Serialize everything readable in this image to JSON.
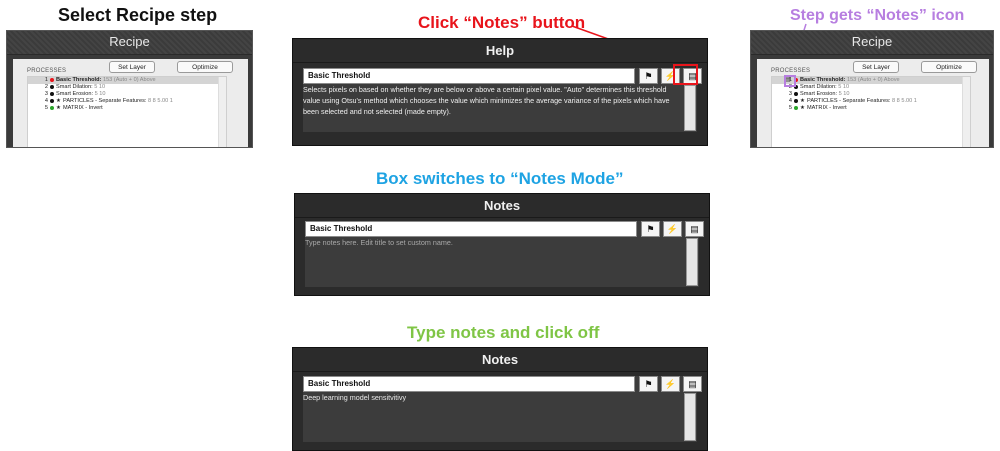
{
  "captions": {
    "select_step": "Select Recipe step",
    "click_notes": "Click “Notes” button",
    "step_gets_icon": "Step gets “Notes” icon",
    "box_switches": "Box switches to “Notes Mode”",
    "type_notes": "Type notes and click off"
  },
  "recipe_left": {
    "title": "Recipe",
    "processes_label": "PROCESSES",
    "set_layer": "Set Layer",
    "optimize": "Optimize",
    "items": [
      {
        "num": "1",
        "color": "#e8141b",
        "star": "",
        "name": "Basic Threshold:",
        "detail": "153 (Auto + 0) Above"
      },
      {
        "num": "2",
        "color": "#111111",
        "star": "",
        "name": "Smart Dilation:",
        "detail": "5 10"
      },
      {
        "num": "3",
        "color": "#111111",
        "star": "",
        "name": "Smart Erosion:",
        "detail": "5 10"
      },
      {
        "num": "4",
        "color": "#111111",
        "star": "★",
        "name": "PARTICLES - Separate Features:",
        "detail": "8 8 5.00 1"
      },
      {
        "num": "5",
        "color": "#2aa52a",
        "star": "★",
        "name": "MATRIX - Invert",
        "detail": ""
      }
    ]
  },
  "recipe_right": {
    "title": "Recipe",
    "processes_label": "PROCESSES",
    "set_layer": "Set Layer",
    "optimize": "Optimize",
    "items": [
      {
        "num": "1",
        "color": "#e8141b",
        "star": "",
        "name": "Basic Threshold:",
        "detail": "153 (Auto + 0) Above"
      },
      {
        "num": "2",
        "color": "#111111",
        "star": "",
        "name": "Smart Dilation:",
        "detail": "5 10"
      },
      {
        "num": "3",
        "color": "#111111",
        "star": "",
        "name": "Smart Erosion:",
        "detail": "5 10"
      },
      {
        "num": "4",
        "color": "#111111",
        "star": "★",
        "name": "PARTICLES - Separate Features:",
        "detail": "8 8 5.00 1"
      },
      {
        "num": "5",
        "color": "#2aa52a",
        "star": "★",
        "name": "MATRIX - Invert",
        "detail": ""
      }
    ]
  },
  "help_panel": {
    "title": "Help",
    "step_title": "Basic Threshold",
    "text": "Selects pixels on based on whether they are below or above a certain pixel value. \"Auto\" determines this threshold value using Otsu's method which chooses the value which minimizes the average variance of the pixels which have been selected and not selected (made empty)."
  },
  "notes_panel_empty": {
    "title": "Notes",
    "step_title": "Basic Threshold",
    "placeholder": "Type notes here. Edit title to set custom name."
  },
  "notes_panel_filled": {
    "title": "Notes",
    "step_title": "Basic Threshold",
    "value": "Deep learning model sensitvitivy"
  },
  "icons": {
    "flag": "⚑",
    "bolt": "⚡",
    "notes": "▤",
    "arrow": "➔"
  }
}
